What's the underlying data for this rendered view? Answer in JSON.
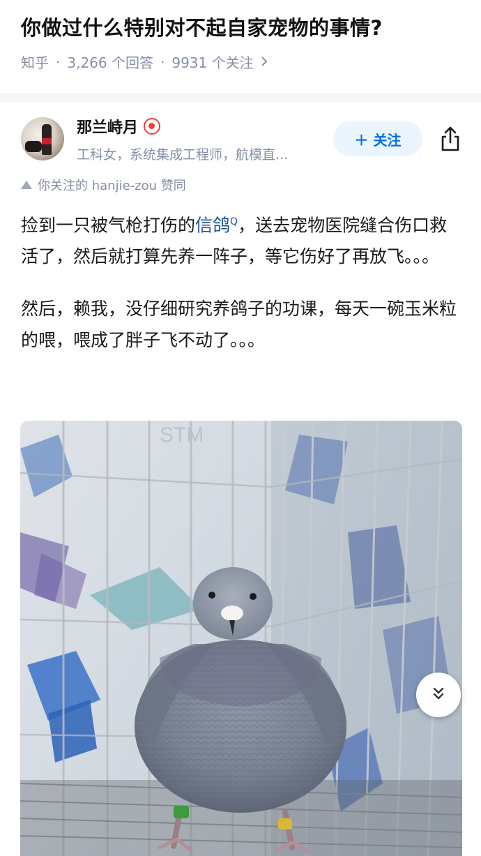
{
  "question": {
    "title": "你做过什么特别对不起自家宠物的事情?",
    "source": "知乎",
    "answers_count": "3,266 个回答",
    "followers_count": "9931 个关注",
    "chevron_icon": "chevron-right-icon"
  },
  "author": {
    "name": "那兰峙月",
    "badge_icon": "certified-badge-icon",
    "description": "工科女，系统集成工程师，航模直...",
    "follow_label": "＋ 关注",
    "share_icon": "share-icon"
  },
  "endorsement": {
    "text": "你关注的 hanjie-zou 赞同"
  },
  "answer": {
    "paragraph1_before": "捡到一只被气枪打伤的",
    "paragraph1_link": "信鸽",
    "paragraph1_link_mark": "Q",
    "paragraph1_after": "，送去宠物医院缝合伤口救活了，然后就打算先养一阵子，等它伤好了再放飞。。。",
    "paragraph2": "然后，赖我，没仔细研究养鸽子的功课，每天一碗玉米粒的喂，喂成了胖子飞不动了。。。"
  },
  "photo": {
    "subject": "fat-pigeon-in-cage",
    "watermark": "STM"
  },
  "controls": {
    "collapse_icon": "double-chevron-down-icon"
  },
  "colors": {
    "brand_blue": "#056de8",
    "follow_bg": "#ebf5ff",
    "muted_text": "#8590a6",
    "link": "#175199",
    "badge_red": "#f1403c"
  }
}
